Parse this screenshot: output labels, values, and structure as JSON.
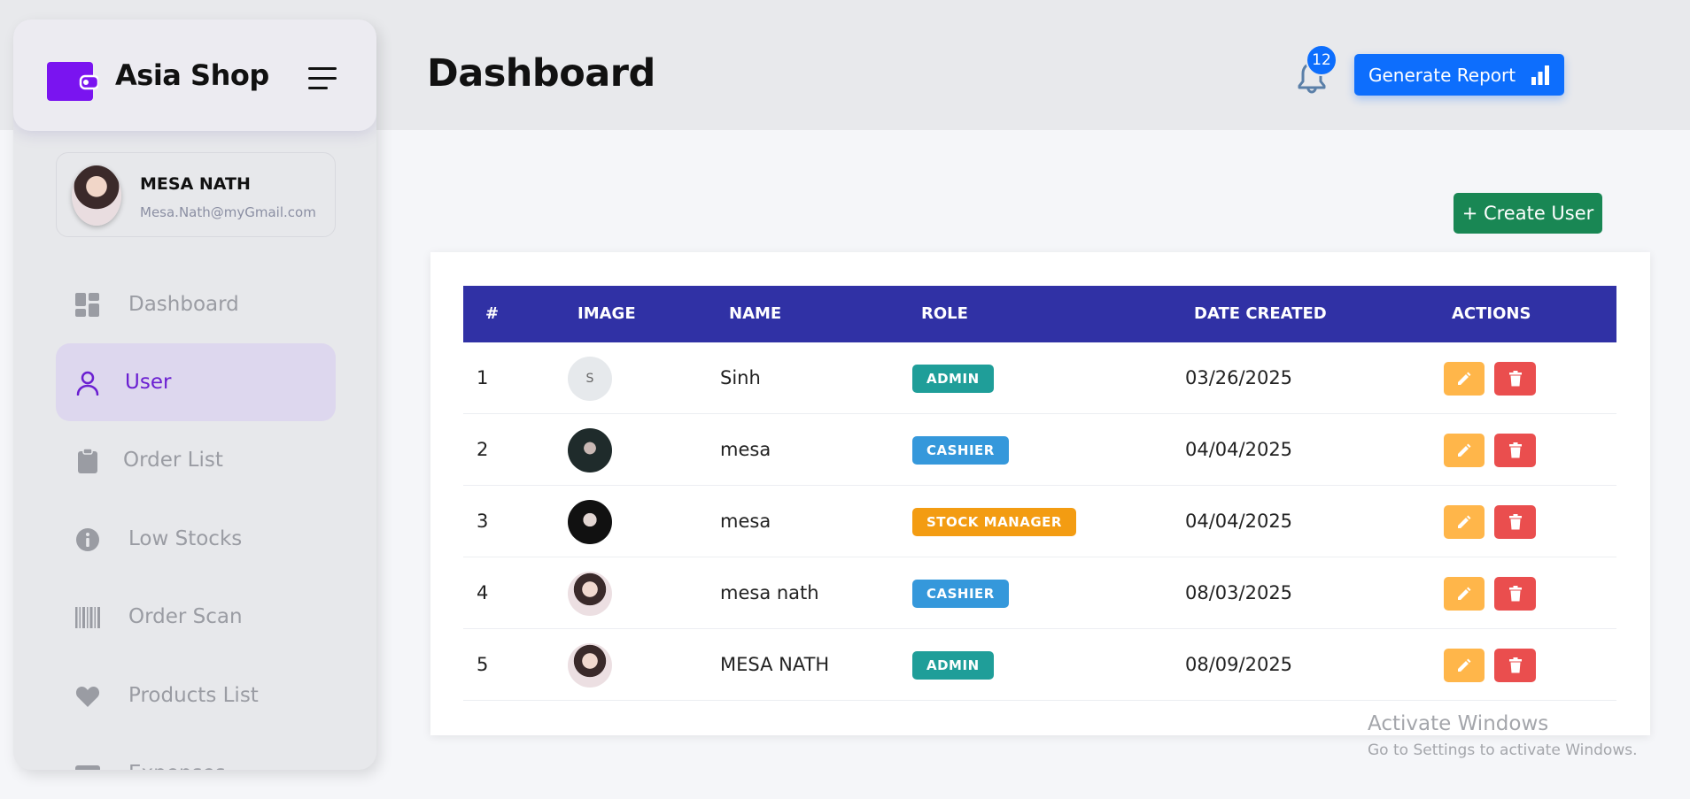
{
  "header": {
    "title": "Dashboard",
    "notification_count": "12",
    "report_label": "Generate Report"
  },
  "brand": {
    "name": "Asia Shop"
  },
  "profile": {
    "name": "MESA NATH",
    "email": "Mesa.Nath@myGmail.com"
  },
  "sidebar": {
    "items": [
      {
        "label": "Dashboard",
        "icon": "dashboard-icon"
      },
      {
        "label": "User",
        "icon": "user-icon",
        "active": true
      },
      {
        "label": "Order List",
        "icon": "clipboard-icon"
      },
      {
        "label": "Low Stocks",
        "icon": "info-icon"
      },
      {
        "label": "Order Scan",
        "icon": "barcode-icon"
      },
      {
        "label": "Products List",
        "icon": "heart-icon"
      },
      {
        "label": "Expenses",
        "icon": "card-icon"
      }
    ]
  },
  "actions": {
    "create_user_label": "+ Create User"
  },
  "table": {
    "headers": [
      "#",
      "IMAGE",
      "NAME",
      "ROLE",
      "DATE CREATED",
      "ACTIONS"
    ],
    "rows": [
      {
        "index": "1",
        "image": "S",
        "name": "Sinh",
        "role": "ADMIN",
        "date": "03/26/2025"
      },
      {
        "index": "2",
        "image": "photo",
        "name": "mesa",
        "role": "CASHIER",
        "date": "04/04/2025"
      },
      {
        "index": "3",
        "image": "photo",
        "name": "mesa",
        "role": "STOCK MANAGER",
        "date": "04/04/2025"
      },
      {
        "index": "4",
        "image": "photo",
        "name": "mesa nath",
        "role": "CASHIER",
        "date": "08/03/2025"
      },
      {
        "index": "5",
        "image": "photo",
        "name": "MESA NATH",
        "role": "ADMIN",
        "date": "08/09/2025"
      }
    ]
  },
  "colors": {
    "accent": "#6a1fd1",
    "primary": "#0d6efd",
    "success": "#198754",
    "table_header": "#3031a5",
    "admin": "#1f9e99",
    "cashier": "#3598db",
    "stock_manager": "#f39c12",
    "edit": "#ffb64a",
    "delete": "#ea4e4e"
  },
  "watermark": {
    "title": "Activate Windows",
    "subtitle": "Go to Settings to activate Windows."
  }
}
